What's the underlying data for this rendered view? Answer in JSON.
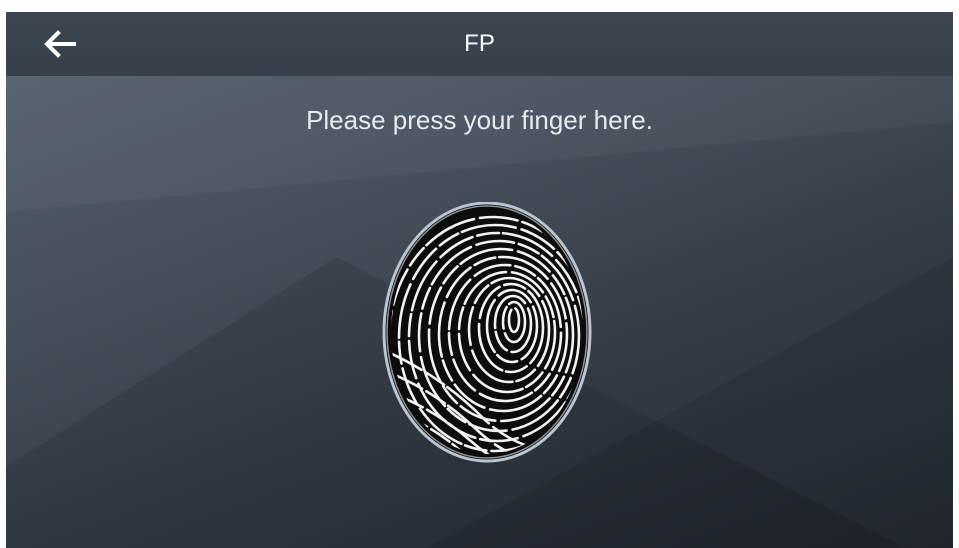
{
  "header": {
    "title": "FP",
    "back_icon": "arrow-left-icon"
  },
  "content": {
    "instruction": "Please press your finger here.",
    "fingerprint_icon": "fingerprint-icon"
  },
  "colors": {
    "header_bg": "#3a444e",
    "background_top": "#566270",
    "background_bottom": "#242a31",
    "text": "#ffffff",
    "fingerprint_outline": "#b9c6d2"
  }
}
